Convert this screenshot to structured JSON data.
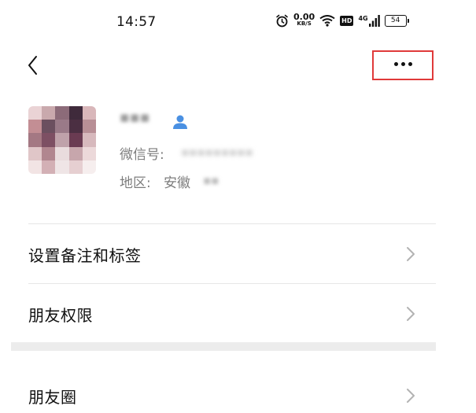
{
  "status_bar": {
    "time": "14:57",
    "net_speed_value": "0.00",
    "net_speed_unit": "KB/S",
    "hd_badge": "HD",
    "network_type": "4G",
    "battery_level": "54"
  },
  "nav": {
    "more_highlight_color": "#e03a3a"
  },
  "profile": {
    "name": "▪▪▪",
    "wechat_id_label": "微信号:",
    "wechat_id_value": "▪▪▪▪▪▪▪▪▪",
    "region_label": "地区:",
    "region_province": "安徽",
    "region_city": "▪▪"
  },
  "menu": {
    "items": [
      {
        "label": "设置备注和标签"
      },
      {
        "label": "朋友权限"
      },
      {
        "label": "朋友圈"
      }
    ]
  },
  "colors": {
    "friend_icon": "#4a90e2",
    "chevron": "#b3b3b3",
    "section_gap": "#ececec"
  }
}
